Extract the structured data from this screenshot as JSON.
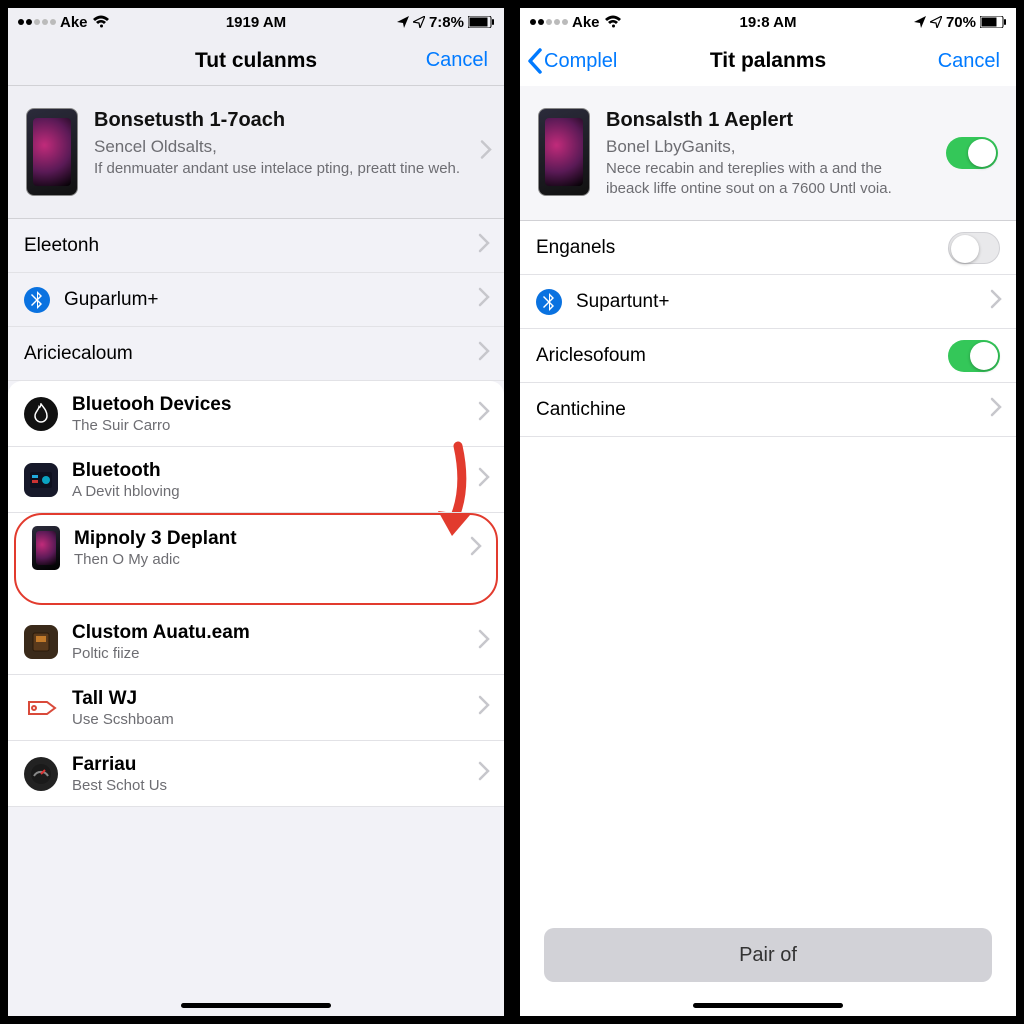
{
  "left": {
    "status": {
      "carrier": "Ake",
      "time": "1919 AM",
      "battery": "7:8%"
    },
    "nav": {
      "title": "Tut culanms",
      "cancel": "Cancel"
    },
    "header": {
      "title": "Bonsetusth 1-7oach",
      "subtitle": "Sencel Oldsalts,",
      "desc": "If denmuater andant use intelace pting, preatt tine weh."
    },
    "rows_top": [
      {
        "label": "Eleetonh"
      },
      {
        "label": "Guparlum+",
        "bt": true
      },
      {
        "label": "Ariciecaloum"
      }
    ],
    "rows_sheet": [
      {
        "title": "Bluetooh Devices",
        "sub": "The Suir Carro",
        "icon": "flame"
      },
      {
        "title": "Bluetooth",
        "sub": "A Devit hbloving",
        "icon": "chip"
      },
      {
        "title": "Mipnoly 3 Deplant",
        "sub": "Then O My adic",
        "icon": "phone",
        "highlight": true
      },
      {
        "title": "Clustom Auatu.eam",
        "sub": "Poltic fiize",
        "icon": "box"
      },
      {
        "title": "Tall WJ",
        "sub": "Use Scshboam",
        "icon": "tag"
      },
      {
        "title": "Farriau",
        "sub": "Best Schot Us",
        "icon": "gauge"
      }
    ]
  },
  "right": {
    "status": {
      "carrier": "Ake",
      "time": "19:8 AM",
      "battery": "70%"
    },
    "nav": {
      "back": "Complel",
      "title": "Tit palanms",
      "cancel": "Cancel"
    },
    "header": {
      "title": "Bonsalsth 1 Aeplert",
      "subtitle": "Bonel LbyGanits,",
      "desc": "Nece recabin and tereplies with a and the ibeack liffe ontine sout on a 7600 Untl voia."
    },
    "rows": [
      {
        "label": "Enganels",
        "control": "toggle-off"
      },
      {
        "label": "Supartunt+",
        "bt": true,
        "control": "chev"
      },
      {
        "label": "Ariclesofoum",
        "control": "toggle-on"
      },
      {
        "label": "Cantichine",
        "control": "chev"
      }
    ],
    "button": "Pair of"
  }
}
